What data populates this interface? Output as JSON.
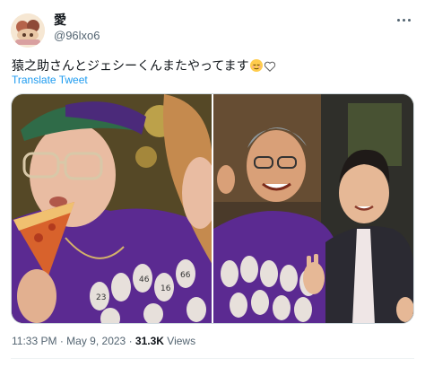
{
  "author": {
    "display_name": "愛",
    "handle": "@96lxo6"
  },
  "tweet": {
    "text": "猿之助さんとジェシーくんまたやってます",
    "emoji_names": [
      "relieved-face-icon",
      "white-heart-icon"
    ],
    "translate_label": "Translate Tweet",
    "time": "11:33 PM",
    "separator": "·",
    "date": "May 9, 2023",
    "views_count": "31.3K",
    "views_label": "Views"
  },
  "media": {
    "left_photo": {
      "shirt_numbers": [
        "23",
        "16",
        "46",
        "66"
      ]
    },
    "right_photo": {}
  },
  "colors": {
    "link": "#1d9bf0",
    "secondary_text": "#536471",
    "primary_text": "#0f1419",
    "shirt_purple": "#5b2a91"
  }
}
